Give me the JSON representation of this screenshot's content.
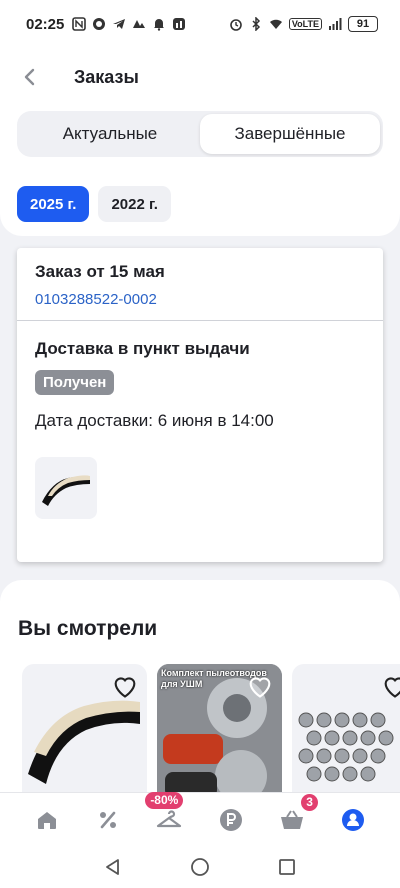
{
  "status_bar": {
    "time": "02:25",
    "battery": "91",
    "network": "VoLTE"
  },
  "header": {
    "title": "Заказы"
  },
  "tabs": [
    {
      "label": "Актуальные",
      "active": false
    },
    {
      "label": "Завершённые",
      "active": true
    }
  ],
  "years": [
    {
      "label": "2025 г.",
      "active": true
    },
    {
      "label": "2022 г.",
      "active": false
    }
  ],
  "order": {
    "title": "Заказ от 15 мая",
    "number": "0103288522-0002",
    "delivery_type": "Доставка в пункт выдачи",
    "status": "Получен",
    "delivery_date": "Дата доставки: 6 июня в 14:00"
  },
  "viewed": {
    "title": "Вы смотрели",
    "products": [
      {
        "image": "brush-strip"
      },
      {
        "image": "grinder-dust-kit",
        "promo": "Комплект пылеотводов для УШМ"
      },
      {
        "image": "collet-set"
      }
    ]
  },
  "bottom_nav": {
    "items": [
      {
        "icon": "home-icon"
      },
      {
        "icon": "percent-icon"
      },
      {
        "icon": "hanger-icon",
        "badge": "-80%"
      },
      {
        "icon": "ruble-icon"
      },
      {
        "icon": "cart-icon",
        "badge": "3"
      },
      {
        "icon": "profile-icon",
        "active": true
      }
    ]
  },
  "colors": {
    "accent": "#1e5cf0",
    "link": "#2b63c7",
    "badge": "#e23f6f",
    "status_badge": "#8c8f96"
  }
}
